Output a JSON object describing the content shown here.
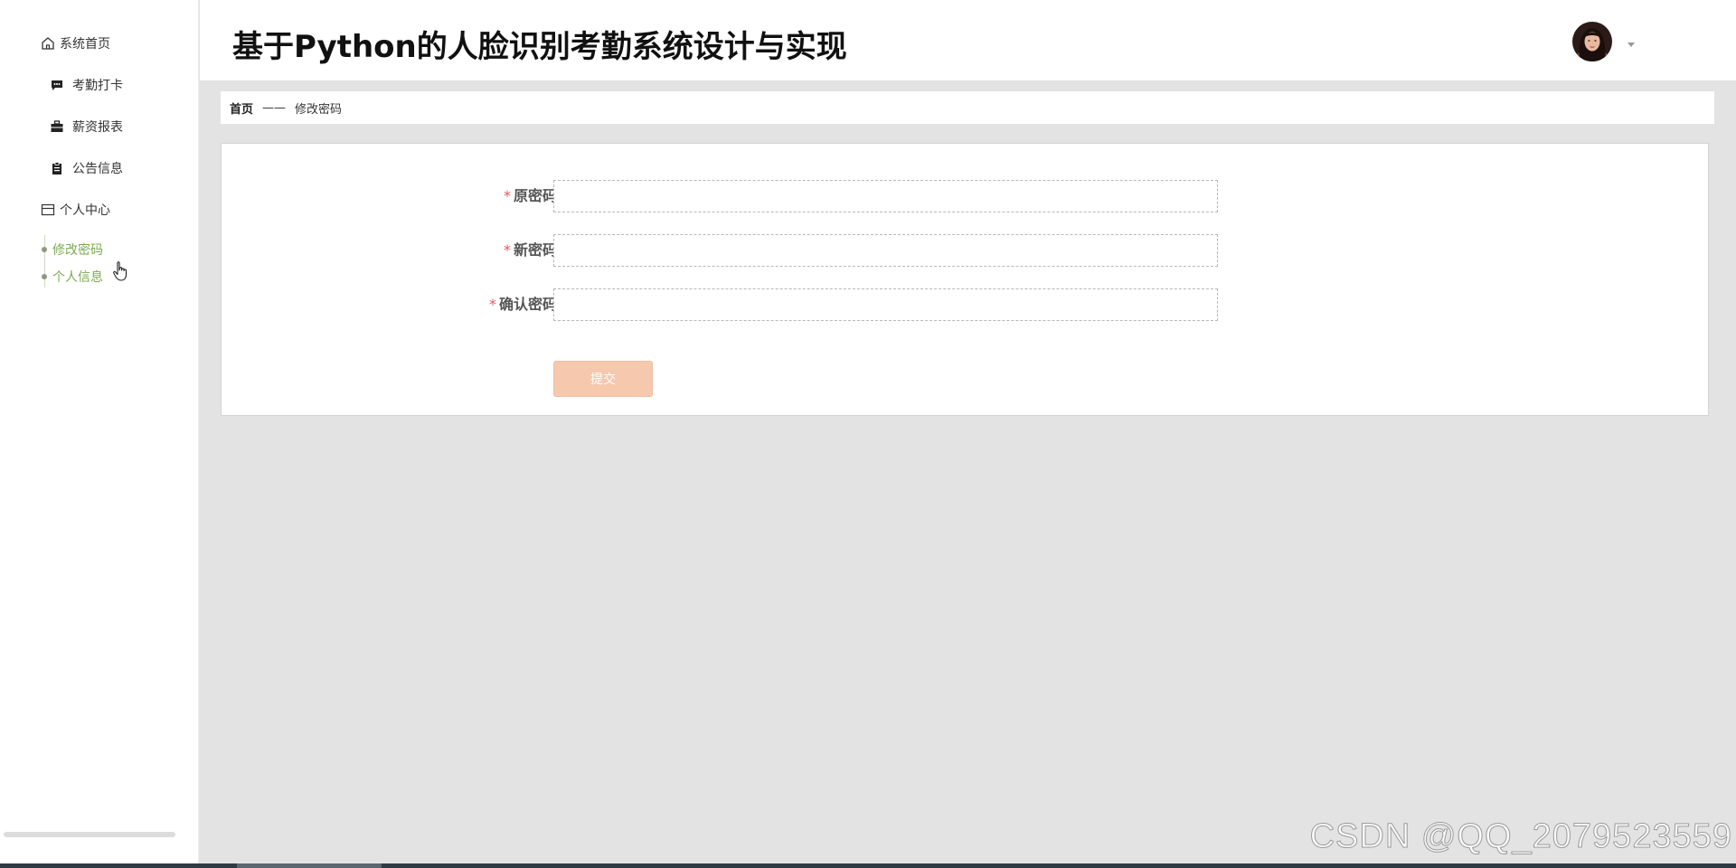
{
  "header": {
    "title": "基于Python的人脸识别考勤系统设计与实现",
    "avatar_icon": "user-avatar-photo"
  },
  "sidebar": {
    "items": [
      {
        "label": "系统首页",
        "icon": "home-icon"
      },
      {
        "label": "考勤打卡",
        "icon": "chat-icon"
      },
      {
        "label": "薪资报表",
        "icon": "briefcase-icon"
      },
      {
        "label": "公告信息",
        "icon": "clipboard-icon"
      },
      {
        "label": "个人中心",
        "icon": "id-card-icon"
      }
    ],
    "submenu": [
      {
        "label": "修改密码"
      },
      {
        "label": "个人信息"
      }
    ]
  },
  "breadcrumb": {
    "home": "首页",
    "separator": "——",
    "current": "修改密码"
  },
  "form": {
    "required_mark": "*",
    "fields": [
      {
        "label": "原密码",
        "value": ""
      },
      {
        "label": "新密码",
        "value": ""
      },
      {
        "label": "确认密码",
        "value": ""
      }
    ],
    "submit_label": "提交"
  },
  "watermark": "CSDN @QQ_2079523559",
  "colors": {
    "accent_green": "#7bab52",
    "submit_button": "#f6c8ae",
    "required_red": "#e05a5a",
    "content_bg": "#e3e3e3"
  }
}
